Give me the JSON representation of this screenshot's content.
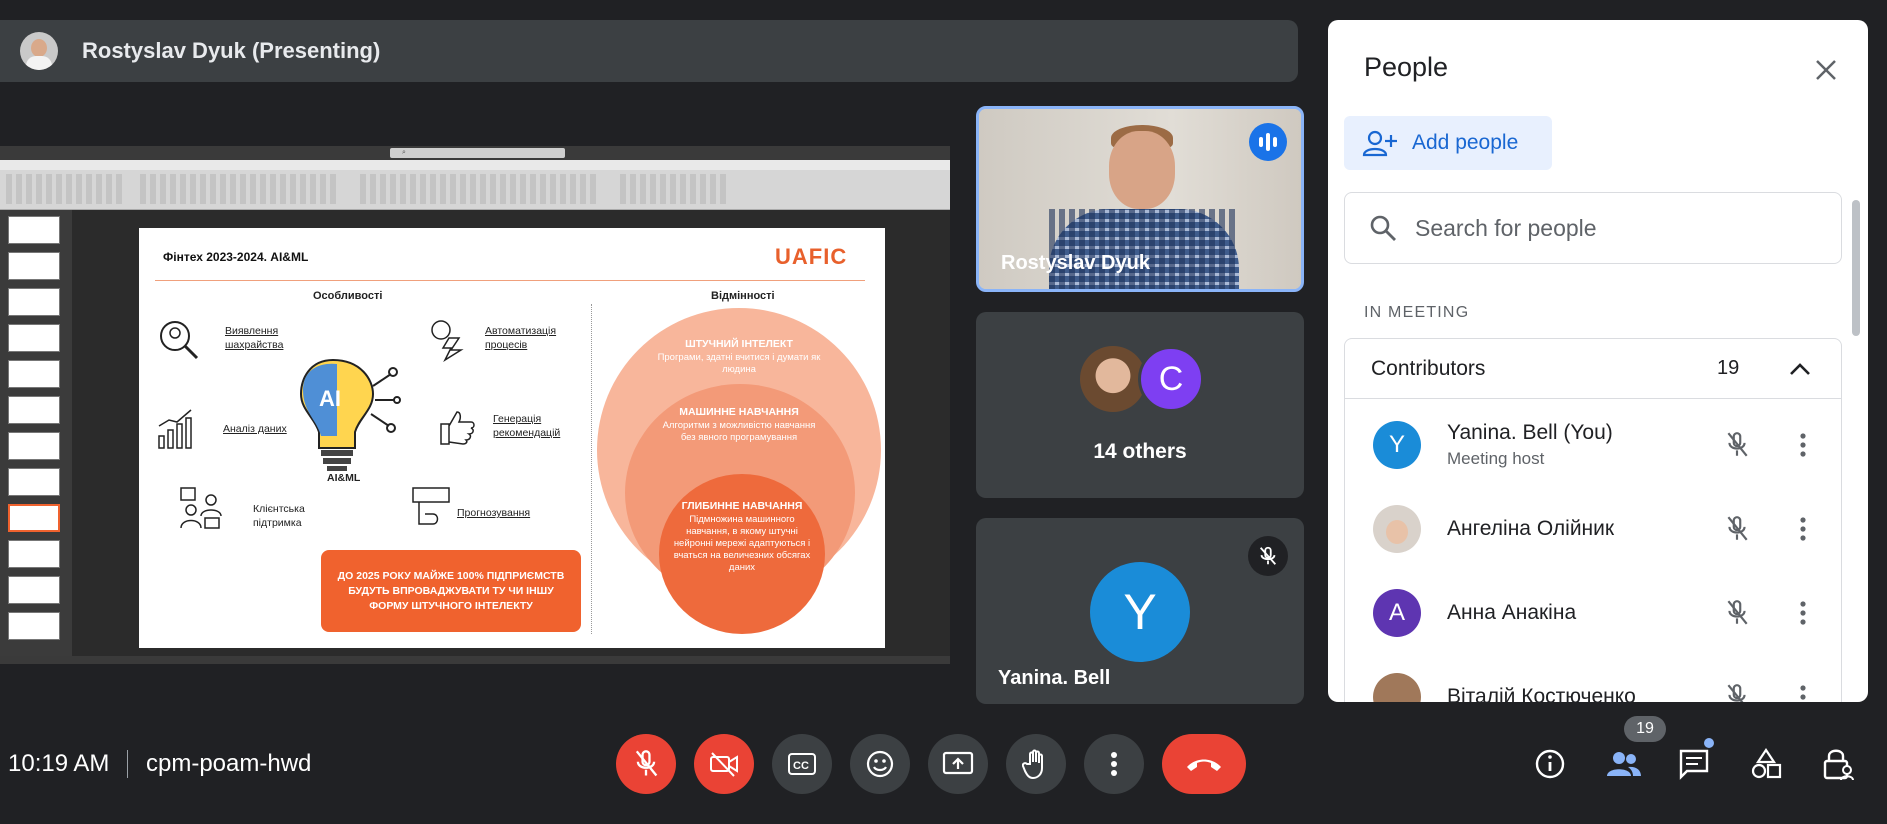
{
  "presenter": {
    "name": "Rostyslav Dyuk (Presenting)"
  },
  "slide": {
    "title": "Фінтех 2023-2024. AI&ML",
    "logo": "UAFIC",
    "col_left": "Особливості",
    "col_right": "Відмінності",
    "features": [
      {
        "line1": "Виявлення",
        "line2": "шахрайства"
      },
      {
        "line1": "Автоматизація",
        "line2": "процесів"
      },
      {
        "line1": "Аналіз даних",
        "line2": ""
      },
      {
        "line1": "Генерація",
        "line2": "рекомендацій"
      },
      {
        "line1": "Клієнтська",
        "line2": "підтримка"
      },
      {
        "line1": "Прогнозування",
        "line2": ""
      }
    ],
    "ai_center": "AI",
    "ai_label": "AI&ML",
    "box_text": "ДО 2025 РОКУ МАЙЖЕ 100% ПІДПРИЄМСТВ БУДУТЬ ВПРОВАДЖУВАТИ ТУ ЧИ ІНШУ ФОРМУ ШТУЧНОГО ІНТЕЛЕКТУ",
    "circles": [
      {
        "title": "ШТУЧНИЙ ІНТЕЛЕКТ",
        "text": "Програми, здатні вчитися і думати як людина"
      },
      {
        "title": "МАШИННЕ НАВЧАННЯ",
        "text": "Алгоритми з можливістю навчання без явного програмування"
      },
      {
        "title": "ГЛИБИННЕ НАВЧАННЯ",
        "text": "Підмножина машинного навчання, в якому штучні нейронні мережі адаптуються і вчаться на величезних обсягах даних"
      }
    ]
  },
  "tiles": {
    "camera_name": "Rostyslav Dyuk",
    "others_avatar_letter": "C",
    "others_label": "14 others",
    "yanina_letter": "Y",
    "yanina_name": "Yanina. Bell"
  },
  "panel": {
    "title": "People",
    "add_people": "Add people",
    "search_placeholder": "Search for people",
    "section": "IN MEETING",
    "group_title": "Contributors",
    "group_count": "19",
    "people": [
      {
        "name": "Yanina. Bell (You)",
        "sub": "Meeting host",
        "letter": "Y",
        "color": "#1a8cd8"
      },
      {
        "name": "Ангеліна Олійник",
        "sub": "",
        "letter": "",
        "color": "#d9d2cb"
      },
      {
        "name": "Анна Анакіна",
        "sub": "",
        "letter": "A",
        "color": "#5e35b1"
      },
      {
        "name": "Віталій Костюченко",
        "sub": "",
        "letter": "",
        "color": "#a0785a"
      }
    ]
  },
  "bottom": {
    "time": "10:19 AM",
    "meeting_code": "cpm-poam-hwd",
    "people_badge": "19"
  },
  "colors": {
    "accent_blue": "#1a73e8",
    "red": "#ea4335",
    "slide_orange": "#f0622e"
  }
}
